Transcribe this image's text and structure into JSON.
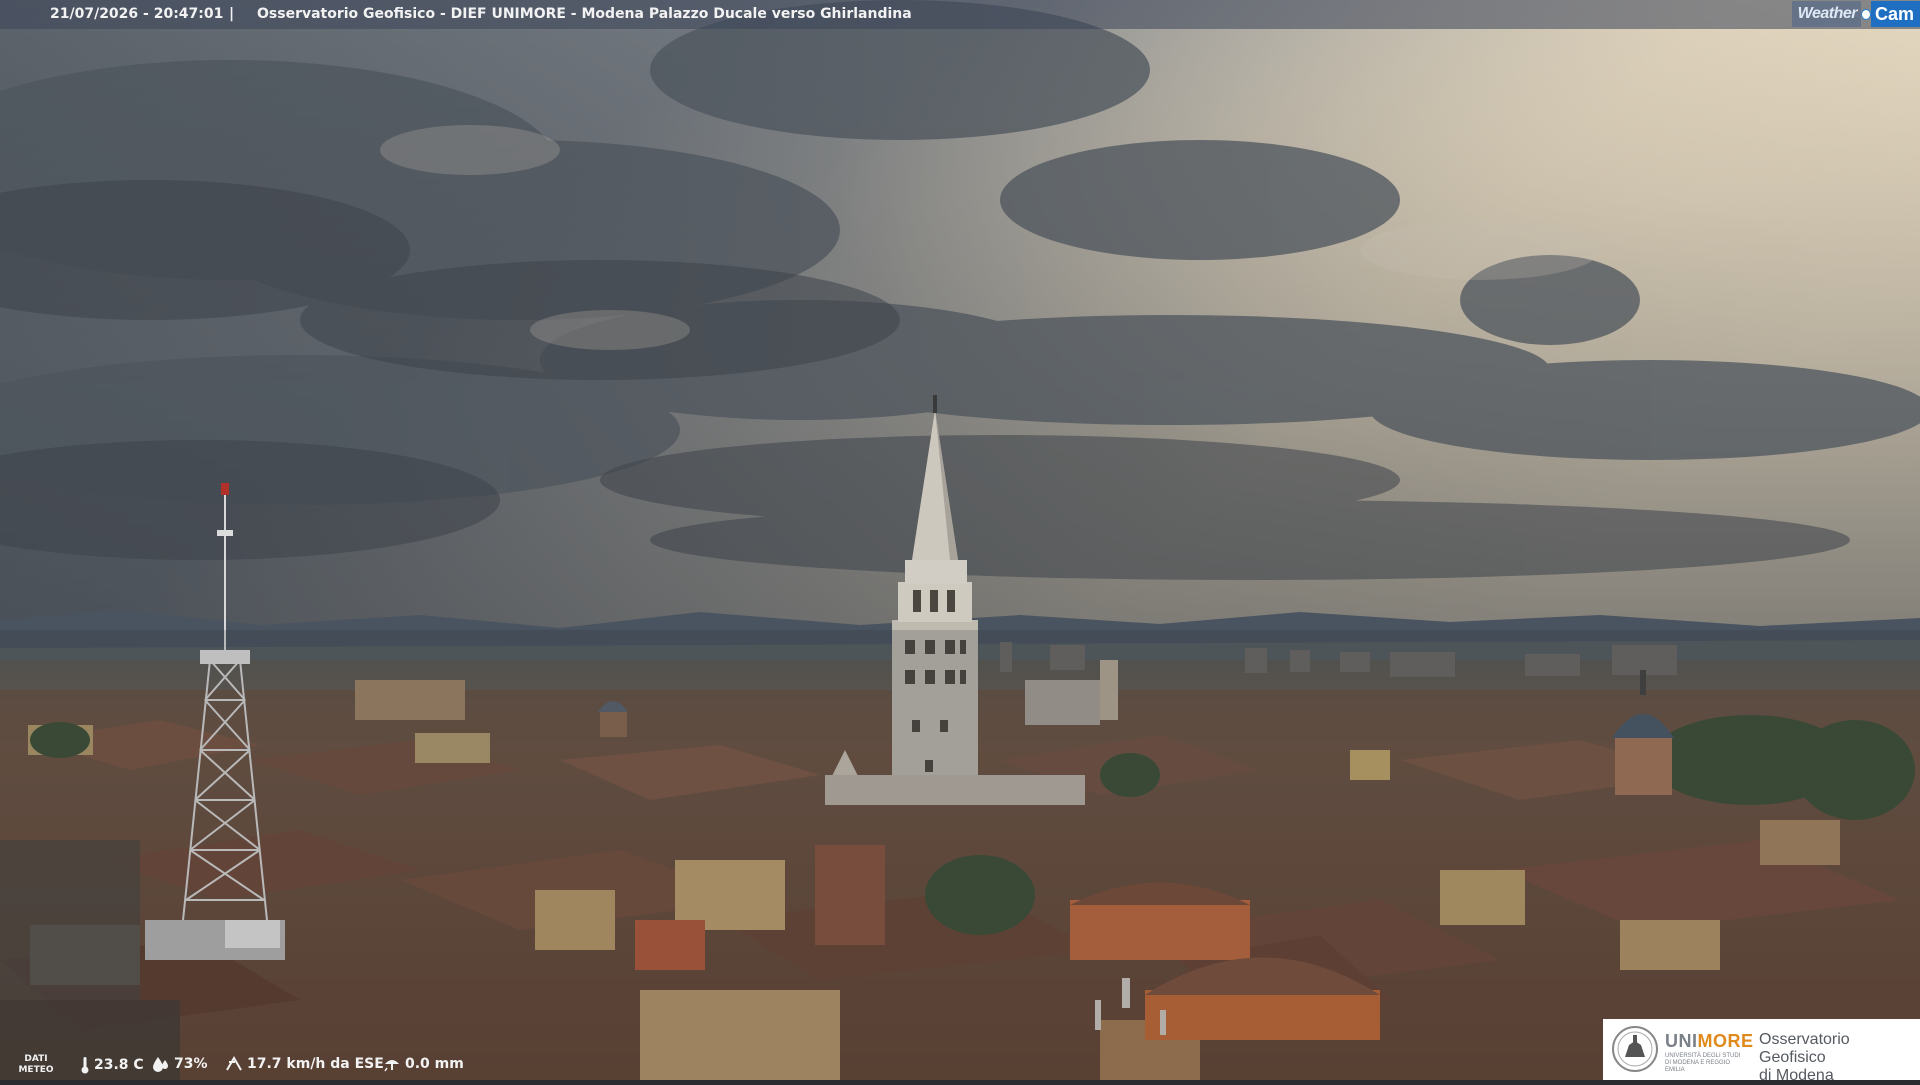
{
  "overlay": {
    "timestamp": "21/07/2026 - 20:47:01",
    "separator": "|",
    "title": "Osservatorio Geofisico - DIEF UNIMORE - Modena Palazzo Ducale verso Ghirlandina",
    "brand_weather": "Weather",
    "brand_cam": "Cam"
  },
  "weather": {
    "label_line1": "DATI",
    "label_line2": "METEO",
    "temperature": "23.8 C",
    "humidity": "73%",
    "wind": "17.7 km/h da ESE",
    "rain": "0.0 mm",
    "icons": [
      "thermometer-icon",
      "humidity-drop-icon",
      "wind-icon",
      "rain-gauge-icon"
    ]
  },
  "logo": {
    "uni_prefix": "UNI",
    "uni_suffix": "MORE",
    "uni_sub": "UNIVERSITÀ DEGLI STUDI DI MODENA E REGGIO EMILIA",
    "obs_line1": "Osservatorio Geofisico",
    "obs_line2": "di Modena"
  },
  "colors": {
    "cam_blue": "#1e6fc2",
    "unimore_blue": "#2d6db5",
    "unimore_orange": "#e08a1c"
  }
}
